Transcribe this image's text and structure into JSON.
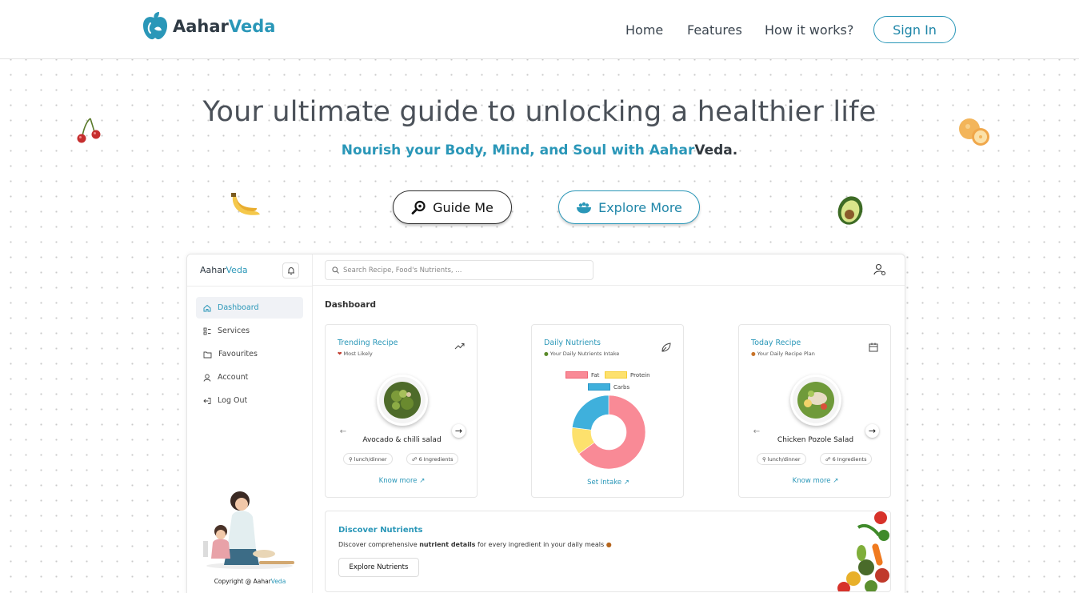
{
  "nav": {
    "logo_part1": "Aahar",
    "logo_part2": "Veda",
    "links": [
      "Home",
      "Features",
      "How it works?"
    ],
    "signin": "Sign In"
  },
  "hero": {
    "title": "Your ultimate guide to unlocking a healthier life",
    "subtitle_part1": "Nourish your Body, Mind, and Soul with Aahar",
    "subtitle_part2": "Veda.",
    "guide_button": "Guide Me",
    "explore_button": "Explore More"
  },
  "dashboard": {
    "brand_part1": "Aahar",
    "brand_part2": "Veda",
    "search_placeholder": "Search Recipe, Food's Nutrients, ...",
    "sidebar": [
      "Dashboard",
      "Services",
      "Favourites",
      "Account",
      "Log Out"
    ],
    "copyright_part1": "Copyright @ Aahar",
    "copyright_part2": "Veda",
    "page_title": "Dashboard",
    "trending": {
      "title": "Trending Recipe",
      "subtitle": "Most Likely",
      "dish": "Avocado & chilli salad",
      "chip1": "lunch/dinner",
      "chip2": "6 Ingredients",
      "link": "Know more"
    },
    "nutrients": {
      "title": "Daily Nutrients",
      "subtitle": "Your Daily Nutrients Intake",
      "link": "Set Intake"
    },
    "today": {
      "title": "Today Recipe",
      "subtitle": "Your Daily Recipe Plan",
      "dish": "Chicken Pozole Salad",
      "chip1": "lunch/dinner",
      "chip2": "6 Ingredients",
      "link": "Know more"
    },
    "discover": {
      "title": "Discover Nutrients",
      "text_before": "Discover comprehensive ",
      "text_bold": "nutrient details",
      "text_after": " for every ingredient in your daily meals",
      "button": "Explore Nutrients"
    }
  },
  "chart_data": {
    "type": "pie",
    "labels": [
      "Fat",
      "Protein",
      "Carbs"
    ],
    "values": [
      65,
      12,
      23
    ],
    "colors": [
      "#f98a96",
      "#fde16d",
      "#3fb0dc"
    ],
    "legend": "top"
  },
  "colors": {
    "accent": "#2a97b8",
    "dark": "#2f3a44"
  }
}
